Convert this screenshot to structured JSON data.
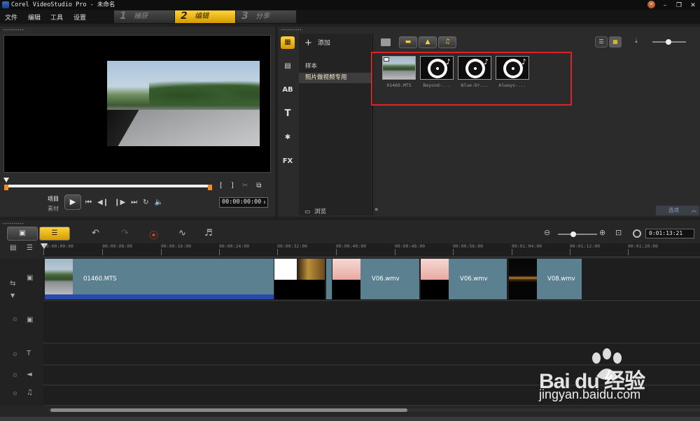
{
  "window": {
    "title": "Corel VideoStudio Pro - 未命名",
    "controls": [
      "ⓦ",
      "–",
      "❐",
      "✕"
    ]
  },
  "menu": [
    "文件",
    "编辑",
    "工具",
    "设置"
  ],
  "steps": [
    {
      "num": "1",
      "label": "捕获",
      "active": false
    },
    {
      "num": "2",
      "label": "编辑",
      "active": true
    },
    {
      "num": "3",
      "label": "分享",
      "active": false
    }
  ],
  "preview": {
    "mode_project": "项目",
    "mode_clip": "素材",
    "mark_in": "[",
    "mark_out": "]",
    "timecode": "00:00:00:00"
  },
  "library": {
    "add_label": "添加",
    "folders": [
      "样本",
      "照片做视频专用"
    ],
    "browse_label": "浏览",
    "options_label": "选项",
    "items": [
      {
        "type": "video",
        "label": "01460.MTS"
      },
      {
        "type": "audio",
        "label": "Beyond-..."
      },
      {
        "type": "audio",
        "label": "Blue-Dr..."
      },
      {
        "type": "audio",
        "label": "Always-..."
      }
    ]
  },
  "timeline": {
    "timecode": "0:01:13:21",
    "ruler": [
      "00:00:00:00",
      "00:00:08:00",
      "00:00:16:00",
      "00:00:24:00",
      "00:00:32:00",
      "00:00:40:00",
      "00:00:48:00",
      "00:00:56:00",
      "00:01:04:00",
      "00:01:12:00",
      "00:01:20:00"
    ],
    "clips": [
      {
        "label": "01460.MTS"
      },
      {
        "label": "V06.wmv"
      },
      {
        "label": "V06.wmv"
      },
      {
        "label": "V08.wmv"
      }
    ]
  },
  "watermark": {
    "brand": "Bai du 经验",
    "url": "jingyan.baidu.com"
  },
  "colors": {
    "accent": "#ffd23a",
    "highlight": "#d9262a",
    "clip": "#5b8190",
    "trim": "#ff8a1c"
  }
}
